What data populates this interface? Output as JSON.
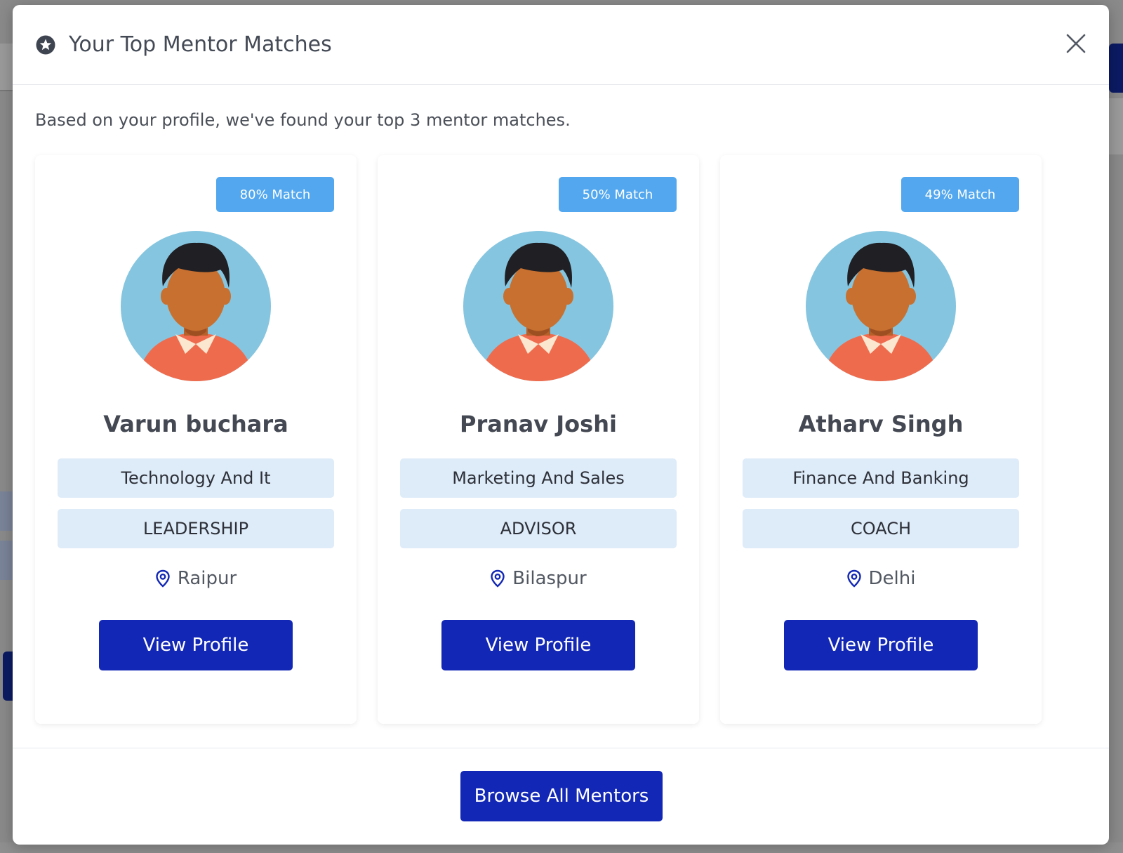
{
  "modal": {
    "title": "Your Top Mentor Matches",
    "intro": "Based on your profile, we've found your top 3 mentor matches.",
    "browse_label": "Browse All Mentors"
  },
  "mentors": [
    {
      "match": "80% Match",
      "name": "Varun buchara",
      "industry": "Technology And It",
      "role": "LEADERSHIP",
      "location": "Raipur",
      "view_label": "View Profile"
    },
    {
      "match": "50% Match",
      "name": "Pranav Joshi",
      "industry": "Marketing And Sales",
      "role": "ADVISOR",
      "location": "Bilaspur",
      "view_label": "View Profile"
    },
    {
      "match": "49% Match",
      "name": "Atharv Singh",
      "industry": "Finance And Banking",
      "role": "COACH",
      "location": "Delhi",
      "view_label": "View Profile"
    }
  ],
  "colors": {
    "primary_button": "#1227b5",
    "match_badge": "#52a7ee",
    "tag_background": "#deebf8",
    "avatar_background": "#86c5df",
    "shirt": "#ef6b4d"
  },
  "icons": {
    "header": "star-circle-icon",
    "close": "close-icon",
    "location": "map-pin-icon"
  }
}
